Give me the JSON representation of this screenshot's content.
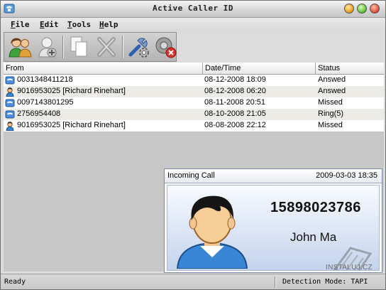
{
  "window": {
    "title": "Active Caller ID"
  },
  "menu": [
    {
      "label_u": "F",
      "label_rest": "ile"
    },
    {
      "label_u": "E",
      "label_rest": "dit"
    },
    {
      "label_u": "T",
      "label_rest": "ools"
    },
    {
      "label_u": "H",
      "label_rest": "elp"
    }
  ],
  "toolbar": {
    "buttons": [
      "contacts-icon",
      "add-contact-icon",
      "copy-icon",
      "delete-icon",
      "settings-icon",
      "disconnect-icon"
    ]
  },
  "list": {
    "columns": [
      "From",
      "Date/Time",
      "Status"
    ],
    "rows": [
      {
        "icon": "phone-icon",
        "from": "0031348411218",
        "datetime": "08-12-2008 18:09",
        "status": "Answed"
      },
      {
        "icon": "person-icon",
        "from": "9016953025 [Richard Rinehart]",
        "datetime": "08-12-2008 06:20",
        "status": "Answed"
      },
      {
        "icon": "phone-icon",
        "from": "0097143801295",
        "datetime": "08-11-2008 20:51",
        "status": "Missed"
      },
      {
        "icon": "phone-icon",
        "from": "2756954408",
        "datetime": "08-10-2008 21:05",
        "status": "Ring(5)"
      },
      {
        "icon": "person-icon",
        "from": "9016953025 [Richard Rinehart]",
        "datetime": "08-08-2008 22:12",
        "status": "Missed"
      }
    ]
  },
  "popup": {
    "title": "Incoming Call",
    "timestamp": "2009-03-03 18:35",
    "number": "15898023786",
    "name": "John Ma"
  },
  "status": {
    "left": "Ready",
    "right": "Detection Mode: TAPI",
    "watermark": "INSTALUJ.CZ"
  },
  "colors": {
    "row_alt": "#ecebe6",
    "popup_gradient_end": "#c4d3ec",
    "avatar_shirt": "#3a86d6"
  }
}
